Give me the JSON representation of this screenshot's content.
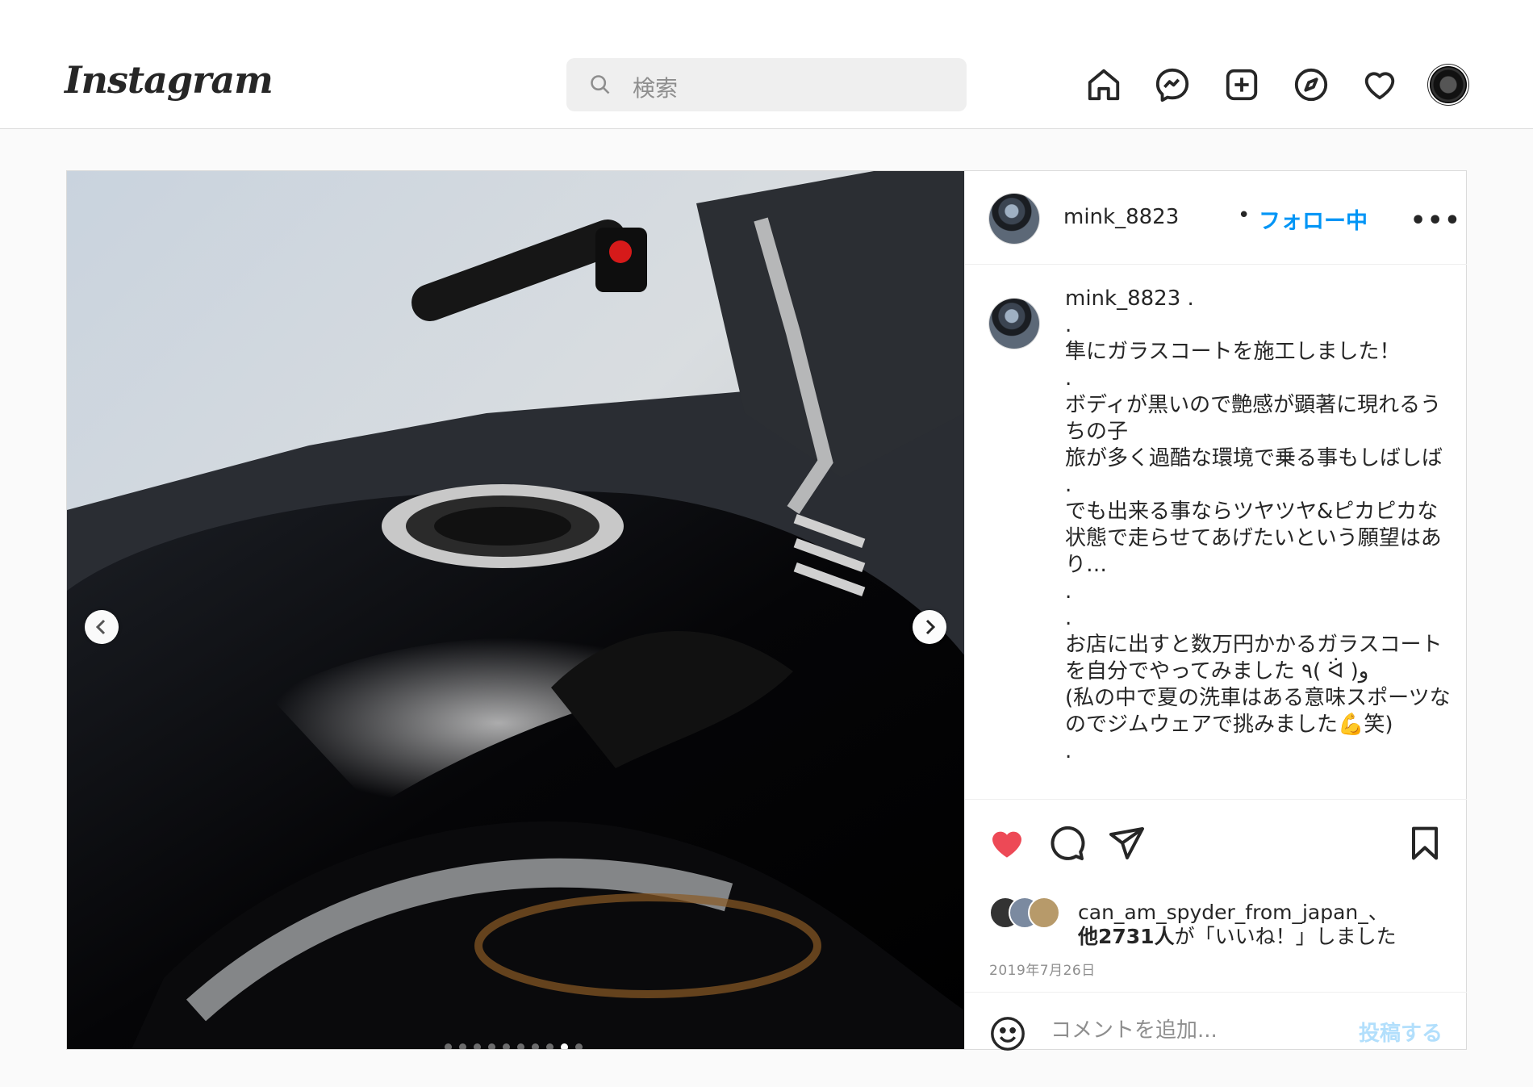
{
  "topbar": {
    "logo": "Instagram",
    "search_placeholder": "検索",
    "nav_icons": [
      "home-icon",
      "messenger-icon",
      "new-post-icon",
      "explore-icon",
      "heart-icon",
      "profile-avatar"
    ]
  },
  "post": {
    "carousel": {
      "count": 10,
      "active_index": 8
    },
    "author": {
      "username": "mink_8823",
      "follow_label": "フォロー中",
      "bullet": "•",
      "more": "•••"
    },
    "caption": {
      "username": "mink_8823",
      "text": " .\n.\n隼にガラスコートを施工しました！\n.\nボディが黒いので艶感が顕著に現れるうちの子\n旅が多く過酷な環境で乗る事もしばしば\n.\nでも出来る事ならツヤツヤ&ピカピカな状態で走らせてあげたいという願望はあり…\n.\n.\nお店に出すと数万円かかるガラスコートを自分でやってみました ٩( ᐛ )و\n(私の中で夏の洗車はある意味スポーツなのでジムウェアで挑みました💪笑)\n."
    },
    "actions": {
      "liked": true,
      "likes_line1": "can_am_spyder_from_japan_、",
      "likes_count_text": "他2731人",
      "likes_suffix": "が「いいね！」しました",
      "date": "2019年7月26日"
    },
    "comment": {
      "placeholder": "コメントを追加...",
      "post_label": "投稿する"
    }
  },
  "colors": {
    "accent": "#0095f6",
    "like": "#ed4956",
    "post_disabled": "#b2dffc"
  }
}
